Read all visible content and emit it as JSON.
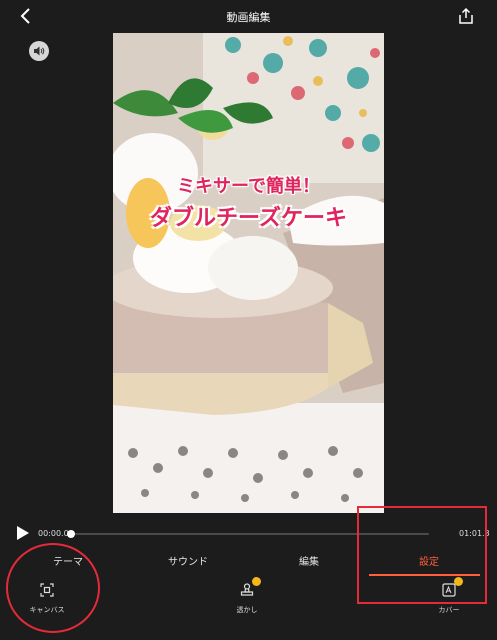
{
  "header": {
    "title": "動画編集"
  },
  "preview": {
    "caption_line1": "ミキサーで簡単！",
    "caption_line2": "ダブルチーズケーキ"
  },
  "playback": {
    "current_time": "00:00.0",
    "total_time": "01:01.3",
    "progress": 0
  },
  "tabs": [
    {
      "label": "テーマ",
      "active": false
    },
    {
      "label": "サウンド",
      "active": false
    },
    {
      "label": "編集",
      "active": false
    },
    {
      "label": "設定",
      "active": true
    }
  ],
  "tools": [
    {
      "label": "キャンバス",
      "icon": "canvas-icon"
    },
    {
      "label": "透かし",
      "icon": "watermark-icon"
    },
    {
      "label": "カバー",
      "icon": "cover-icon"
    }
  ],
  "colors": {
    "accent": "#ff5f3a",
    "background": "#1c1c1c",
    "annotation": "#e52b3a",
    "caption": "#e0245e"
  }
}
